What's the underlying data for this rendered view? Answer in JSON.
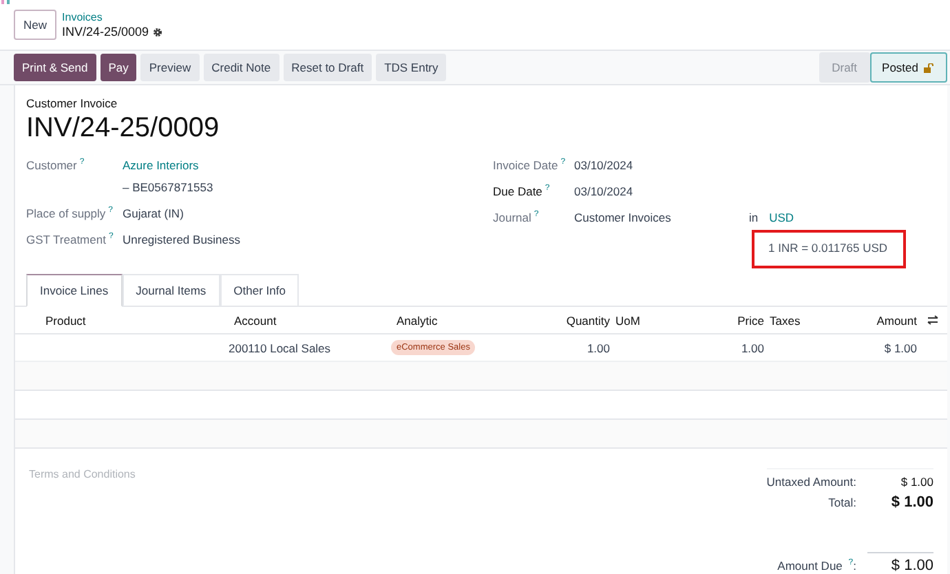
{
  "breadcrumb": {
    "new_button": "New",
    "parent": "Invoices",
    "current": "INV/24-25/0009"
  },
  "actions": [
    {
      "label": "Print & Send",
      "kind": "primary"
    },
    {
      "label": "Pay",
      "kind": "primary"
    },
    {
      "label": "Preview",
      "kind": "secondary"
    },
    {
      "label": "Credit Note",
      "kind": "secondary"
    },
    {
      "label": "Reset to Draft",
      "kind": "secondary"
    },
    {
      "label": "TDS Entry",
      "kind": "secondary"
    }
  ],
  "status_steps": [
    {
      "label": "Draft",
      "selected": false
    },
    {
      "label": "Posted",
      "selected": true
    }
  ],
  "form": {
    "type_label": "Customer Invoice",
    "number": "INV/24-25/0009",
    "left_fields": [
      {
        "label": "Customer",
        "help": "?",
        "value": "Azure Interiors",
        "link": true,
        "subvalue": "– BE0567871553"
      },
      {
        "label": "Place of supply",
        "help": "?",
        "value": "Gujarat (IN)",
        "link": false
      },
      {
        "label": "GST Treatment",
        "help": "?",
        "value": "Unregistered Business",
        "link": false
      }
    ],
    "right_fields": [
      {
        "label": "Invoice Date",
        "help": "?",
        "value": "03/10/2024",
        "required": false
      },
      {
        "label": "Due Date",
        "help": "?",
        "value": "03/10/2024",
        "required": true
      },
      {
        "label": "Journal",
        "help": "?",
        "value": "Customer Invoices",
        "required": false
      }
    ],
    "currency": {
      "prefix": "in",
      "value": "USD"
    },
    "rate": {
      "text": "1 INR = 0.011765 USD",
      "highlighted": true
    }
  },
  "tabs": [
    {
      "label": "Invoice Lines",
      "selected": true
    },
    {
      "label": "Journal Items",
      "selected": false
    },
    {
      "label": "Other Info",
      "selected": false
    }
  ],
  "table": {
    "columns": [
      {
        "label": "Product",
        "kind": "text"
      },
      {
        "label": "Account",
        "kind": "text"
      },
      {
        "label": "Analytic",
        "kind": "text"
      },
      {
        "label": "Quantity",
        "kind": "number"
      },
      {
        "label": "UoM",
        "kind": "text"
      },
      {
        "label": "Price",
        "kind": "number"
      },
      {
        "label": "Taxes",
        "kind": "text"
      },
      {
        "label": "Amount",
        "kind": "number"
      }
    ],
    "rows": [
      {
        "cells": [
          {
            "kind": "empty"
          },
          {
            "kind": "text",
            "value": "200110 Local Sales"
          },
          {
            "kind": "tag",
            "value": "eCommerce Sales"
          },
          {
            "kind": "text",
            "value": "1.00"
          },
          {
            "kind": "empty"
          },
          {
            "kind": "text",
            "value": "1.00"
          },
          {
            "kind": "empty"
          },
          {
            "kind": "text",
            "value": "$ 1.00"
          }
        ]
      }
    ]
  },
  "terms_placeholder": "Terms and Conditions",
  "totals": [
    {
      "label": "Untaxed Amount:",
      "value": "$ 1.00",
      "kind": "line"
    },
    {
      "label": "Total:",
      "value": "$ 1.00",
      "kind": "grand"
    }
  ],
  "amount_due": {
    "label": "Amount Due",
    "help": "?",
    "colon": ":",
    "value": "$ 1.00"
  }
}
